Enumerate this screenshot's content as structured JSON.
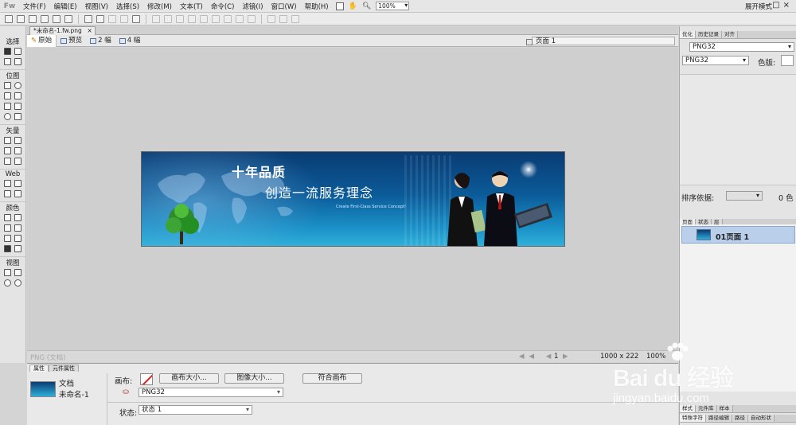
{
  "app": {
    "logo": "Fw",
    "workspace_label": "展开模式",
    "zoom": "100%"
  },
  "menu": {
    "items": [
      "文件(F)",
      "编辑(E)",
      "视图(V)",
      "选择(S)",
      "修改(M)",
      "文本(T)",
      "命令(C)",
      "滤镜(I)",
      "窗口(W)",
      "帮助(H)"
    ]
  },
  "tools": {
    "sections": [
      "选择",
      "位图",
      "矢量",
      "Web",
      "颜色",
      "视图"
    ]
  },
  "document": {
    "tab_label": "*未命名-1.fw.png",
    "close_glyph": "×",
    "view_tabs": [
      "原始",
      "预览",
      "2 幅",
      "4 幅"
    ],
    "page_selector": "页面 1"
  },
  "banner": {
    "title_line1": "十年品质",
    "title_line2": "创造一流服务理念",
    "subtitle": "Create First-Class Service Concept!"
  },
  "canvas_status": {
    "format": "PNG (文档)",
    "nav_glyphs": "◀◀ ◀ ▶",
    "page": "1",
    "dimensions": "1000 x 222",
    "zoom": "100%"
  },
  "properties": {
    "tabs": [
      "属性",
      "元件属性"
    ],
    "doc_label": "文档",
    "doc_name": "未命名-1",
    "canvas_label": "画布:",
    "canvas_size_button": "画布大小...",
    "image_size_button": "图像大小...",
    "fit_canvas_button": "符合画布",
    "export_format": "PNG32",
    "state_label": "状态:",
    "state_value": "状态 1"
  },
  "right_panel": {
    "top_tabs": [
      "优化",
      "历史记录",
      "对齐"
    ],
    "optimize_preset": "PNG32",
    "format": "PNG32",
    "colors_label": "色版:",
    "sort_label": "排序依据:",
    "sort_count": "0 色",
    "pages_tabs": [
      "页面",
      "状态",
      "层"
    ],
    "page_item": "01页面 1",
    "bottom_tabs_1": [
      "样式",
      "元件库",
      "样本"
    ],
    "bottom_tabs_2": [
      "特殊字符",
      "路径编辑",
      "路径",
      "自动形状"
    ]
  },
  "watermark": {
    "brand": "Bai du 经验",
    "url": "jingyan.baidu.com"
  }
}
